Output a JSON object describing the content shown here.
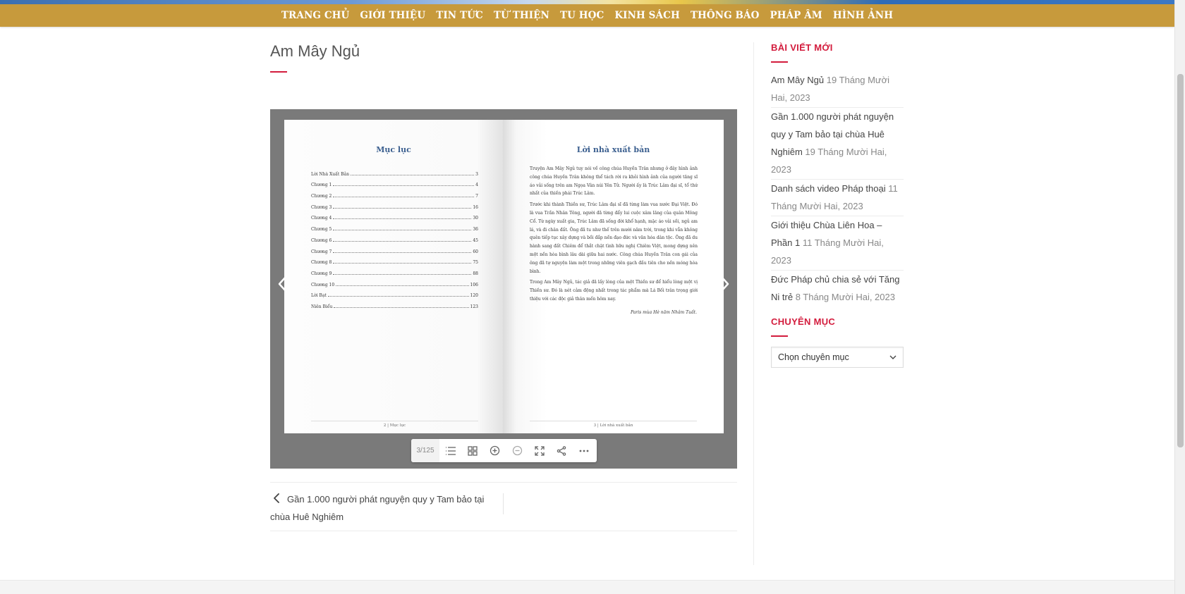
{
  "nav": {
    "items": [
      "TRANG CHỦ",
      "GIỚI THIỆU",
      "TIN TỨC",
      "TỪ THIỆN",
      "TU HỌC",
      "KINH SÁCH",
      "THÔNG BÁO",
      "PHÁP ÂM",
      "HÌNH ẢNH"
    ]
  },
  "post": {
    "title": "Am Mây Ngủ"
  },
  "flipbook": {
    "left_page": {
      "heading": "Mục lục",
      "toc": [
        {
          "label": "Lời Nhà Xuất Bản",
          "page": "3"
        },
        {
          "label": "Chương 1",
          "page": "4"
        },
        {
          "label": "Chương 2",
          "page": "7"
        },
        {
          "label": "Chương 3",
          "page": "16"
        },
        {
          "label": "Chương 4",
          "page": "30"
        },
        {
          "label": "Chương 5",
          "page": "36"
        },
        {
          "label": "Chương 6",
          "page": "45"
        },
        {
          "label": "Chương 7",
          "page": "60"
        },
        {
          "label": "Chương 8",
          "page": "75"
        },
        {
          "label": "Chương 9",
          "page": "88"
        },
        {
          "label": "Chương 10",
          "page": "106"
        },
        {
          "label": "Lời Bạt",
          "page": "120"
        },
        {
          "label": "Niên Biểu",
          "page": "123"
        }
      ],
      "footer": "2 | Mục lục"
    },
    "right_page": {
      "heading": "Lời nhà xuất bản",
      "paragraphs": [
        "Truyện Am Mây Ngủ tuy nói về công chúa Huyền Trân nhưng ở đây hình ảnh công chúa Huyền Trân không thể tách rời ra khỏi hình ảnh của người tăng sĩ áo vải sống trên am Ngọa Vân núi Yên Tử. Người ấy là Trúc Lâm đại sĩ, tổ thứ nhất của thiền phái Trúc Lâm.",
        "Trước khi thành Thiền sư, Trúc Lâm đại sĩ đã từng làm vua nước Đại Việt. Đó là vua Trần Nhân Tông, người đã từng đẩy lui cuộc xâm lăng của quân Mông Cổ. Từ ngày xuất gia, Trúc Lâm đã sống đời khổ hạnh, mặc áo vải sồi, ngủ am lá, và đi chân đất. Ông đã tu như thế trên mười năm trời, trong khi vẫn không quên tiếp tục xây dựng và bồi đắp nền đạo đức và văn hóa dân tộc. Ông đã du hành sang đất Chiêm để thắt chặt tình hữu nghị Chiêm Việt, mong dựng nên một nền hòa bình lâu dài giữa hai nước. Công chúa Huyền Trân con gái của ông đã tự nguyện làm một trong những viên gạch đầu tiên cho nền móng hòa bình.",
        "Trong Am Mây Ngủ, tác giả đã lấy lòng của một Thiền sư để hiểu lòng một vị Thiền sư. Đó là nét cảm động nhất trong tác phẩm mà Lá Bối trân trọng giới thiệu với các độc giả thân mến hôm nay."
      ],
      "signature": "Paris mùa Hè năm Nhâm Tuất.",
      "footer": "3 | Lời nhà xuất bản"
    },
    "toolbar": {
      "page_indicator": "3/125",
      "buttons": [
        "list-icon",
        "grid-icon",
        "zoom-in-icon",
        "zoom-out-icon",
        "fullscreen-icon",
        "share-icon",
        "more-icon"
      ]
    }
  },
  "post_navigation": {
    "prev_label": "Gần 1.000 người phát nguyện quy y Tam bảo tại chùa Huê Nghiêm"
  },
  "sidebar": {
    "recent_title": "BÀI VIẾT MỚI",
    "recent_posts": [
      {
        "title": "Am Mây Ngủ",
        "date": "19 Tháng Mười Hai, 2023"
      },
      {
        "title": "Gần 1.000 người phát nguyện quy y Tam bảo tại chùa Huê Nghiêm",
        "date": "19 Tháng Mười Hai, 2023"
      },
      {
        "title": "Danh sách video Pháp thoại",
        "date": "11 Tháng Mười Hai, 2023"
      },
      {
        "title": "Giới thiệu Chùa Liên Hoa – Phần 1",
        "date": "11 Tháng Mười Hai, 2023"
      },
      {
        "title": "Đức Pháp chủ chia sẻ với Tăng Ni trẻ",
        "date": "8 Tháng Mười Hai, 2023"
      }
    ],
    "category_title": "CHUYÊN MỤC",
    "category_select": "Chọn chuyên mục"
  },
  "colors": {
    "nav_bg": "#c79a3c",
    "accent": "#d31c3d",
    "flipbook_bg": "#7a7a7a",
    "toc_heading": "#3b5f8f"
  }
}
